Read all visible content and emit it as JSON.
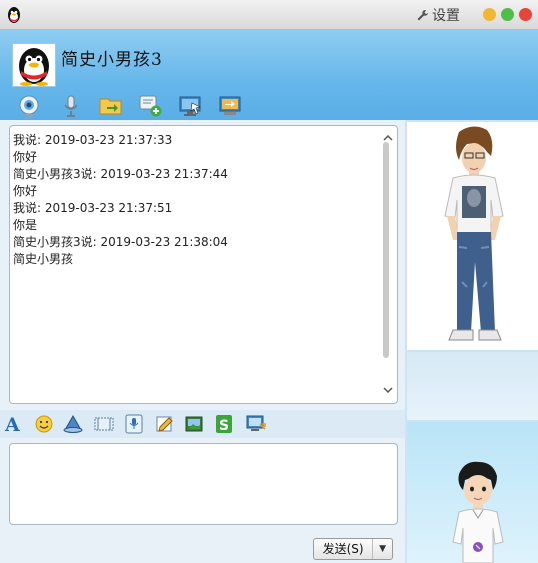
{
  "titlebar": {
    "settings_label": "设置"
  },
  "header": {
    "contact_name": "简史小男孩3"
  },
  "messages": [
    {
      "text": "我说: 2019-03-23 21:37:33"
    },
    {
      "text": "你好"
    },
    {
      "text": "简史小男孩3说: 2019-03-23 21:37:44"
    },
    {
      "text": "你好"
    },
    {
      "text": "我说: 2019-03-23 21:37:51"
    },
    {
      "text": "你是"
    },
    {
      "text": "简史小男孩3说: 2019-03-23 21:38:04"
    },
    {
      "text": "简史小男孩"
    }
  ],
  "input": {
    "value": ""
  },
  "send_button": {
    "label": "发送(S)"
  },
  "icons": {
    "top_toolbar": [
      "video-call-icon",
      "voice-call-icon",
      "file-transfer-icon",
      "add-group-icon",
      "remote-assist-icon",
      "screen-share-icon"
    ],
    "mid_toolbar": [
      "font-icon",
      "emoji-icon",
      "shake-icon",
      "screenshot-icon",
      "voice-message-icon",
      "graffiti-icon",
      "image-icon",
      "music-icon",
      "screen-capture-icon"
    ]
  },
  "colors": {
    "header": "#65b6ea",
    "close": "#e9443a",
    "minimize": "#f2b731",
    "maximize": "#4fbd4a"
  }
}
